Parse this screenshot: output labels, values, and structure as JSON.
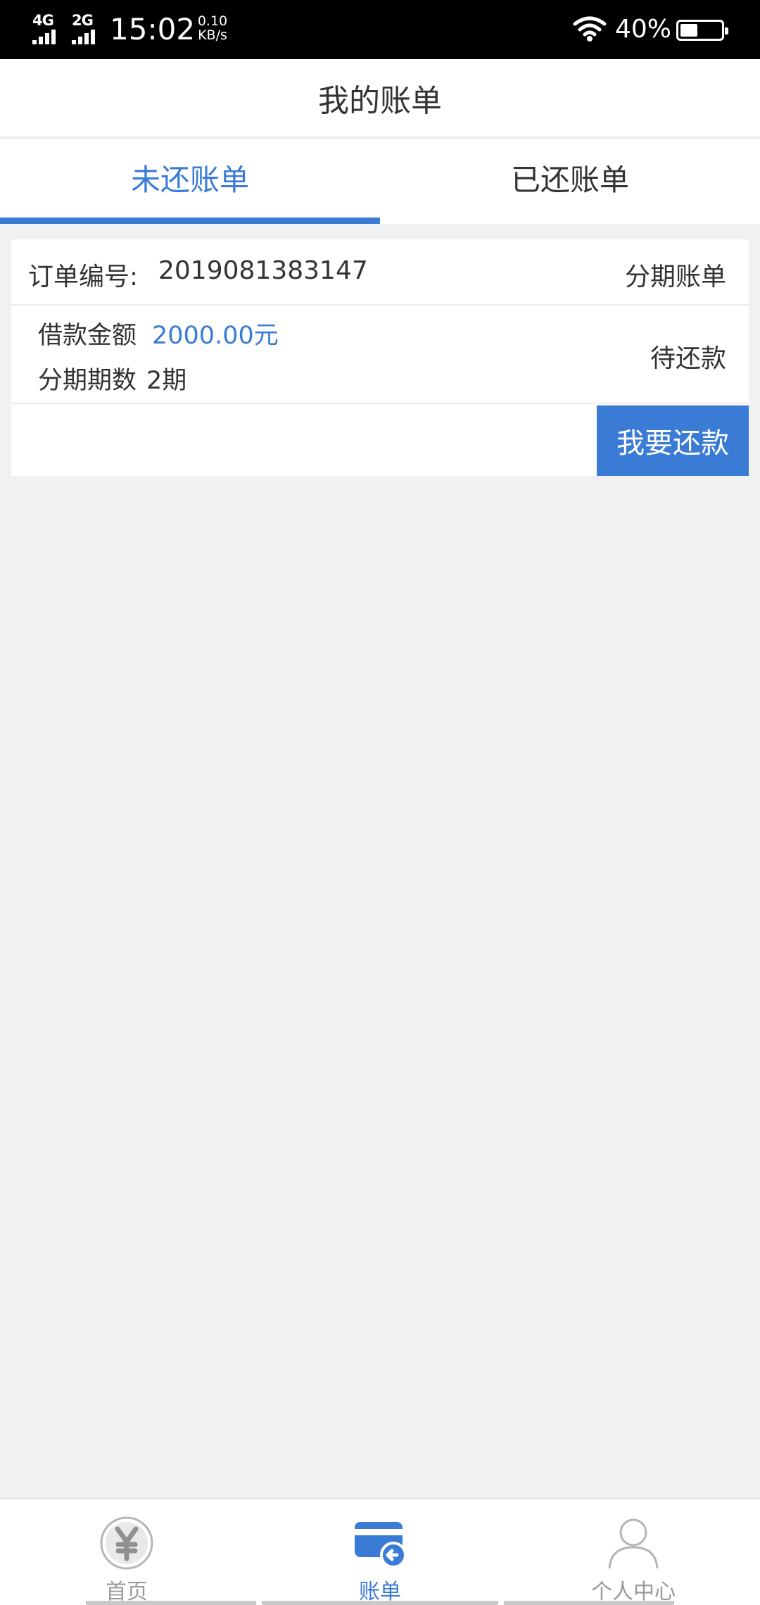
{
  "status_bar": {
    "network_a": "4G",
    "network_b": "2G",
    "time": "15:02",
    "net_speed_value": "0.10",
    "net_speed_unit": "KB/s",
    "battery": "40%",
    "battery_level": 0.4,
    "icons": [
      "signal-icon",
      "wifi-icon",
      "battery-icon"
    ]
  },
  "header": {
    "title": "我的账单"
  },
  "tabs": [
    {
      "label": "未还账单",
      "active": true
    },
    {
      "label": "已还账单",
      "active": false
    }
  ],
  "bill_card": {
    "order_label": "订单编号:",
    "order_number": "2019081383147",
    "bill_type": "分期账单",
    "amount_label": "借款金额",
    "amount_value": "2000.00元",
    "period_label": "分期期数",
    "period_value": "2期",
    "status": "待还款",
    "repay_button": "我要还款"
  },
  "bottom_nav": [
    {
      "label": "首页",
      "icon": "yen-icon",
      "active": false
    },
    {
      "label": "账单",
      "icon": "card-icon",
      "active": true
    },
    {
      "label": "个人中心",
      "icon": "user-icon",
      "active": false
    }
  ],
  "colors": {
    "accent": "#3a7bd5",
    "background": "#f0f1f2",
    "text": "#333333",
    "inactive": "#9a9a9a"
  }
}
